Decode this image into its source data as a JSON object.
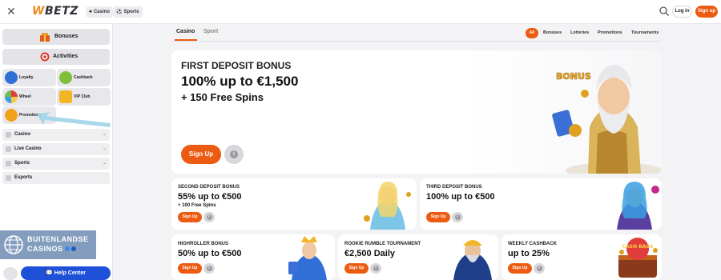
{
  "header": {
    "logo_w": "W",
    "logo_rest": "BETZ",
    "nav_pills": [
      {
        "icon": "cards-icon",
        "label": "Casino"
      },
      {
        "icon": "ball-icon",
        "label": "Sports"
      }
    ],
    "login_label": "Log in",
    "signup_label": "Sign up"
  },
  "sidebar": {
    "big_buttons": [
      {
        "label": "Bonuses",
        "icon": "gift-icon"
      },
      {
        "label": "Activities",
        "icon": "target-icon"
      }
    ],
    "tiles": [
      {
        "label": "Loyalty",
        "icon": "shield-icon"
      },
      {
        "label": "Cashback",
        "icon": "cash-icon"
      },
      {
        "label": "Wheel",
        "icon": "wheel-icon"
      },
      {
        "label": "VIP Club",
        "icon": "crown-icon"
      },
      {
        "label": "Promotions",
        "icon": "coin-icon"
      }
    ],
    "rows": [
      {
        "label": "Casino"
      },
      {
        "label": "Live Casino"
      },
      {
        "label": "Sports"
      },
      {
        "label": "Esports"
      }
    ],
    "help_label": "Help Center"
  },
  "watermark": {
    "line1": "BUITENLANDSE",
    "line2": "CASINOS"
  },
  "main": {
    "tabs": [
      {
        "label": "Casino",
        "active": true
      },
      {
        "label": "Sport",
        "active": false
      }
    ],
    "filters": [
      "All",
      "Bonuses",
      "Lotteries",
      "Promotions",
      "Tournaments"
    ],
    "hero": {
      "title": "FIRST DEPOSIT BONUS",
      "line1": "100% up to €1,500",
      "line2": "+ 150 Free Spins",
      "button": "Sign Up",
      "art_text": "BONUS"
    },
    "cards": [
      {
        "title": "SECOND DEPOSIT BONUS",
        "line1": "55% up to €500",
        "line2": "+ 100 Free Spins",
        "button": "Sign Up"
      },
      {
        "title": "THIRD DEPOSIT BONUS",
        "line1": "100% up to €500",
        "line2": "",
        "button": "Sign Up"
      },
      {
        "title": "HIGHROLLER BONUS",
        "line1": "50% up to €500",
        "line2": "",
        "button": "Sign Up"
      },
      {
        "title": "ROOKIE RUMBLE TOURNAMENT",
        "line1": "€2,500 Daily",
        "line2": "",
        "button": "Sign Up"
      },
      {
        "title": "WEEKLY CASHBACK",
        "line1": "up to 25%",
        "line2": "",
        "button": "Sign Up",
        "art_text": "CASH BACK"
      }
    ]
  },
  "colors": {
    "accent": "#ec5b12",
    "help_blue": "#1f50d8",
    "logo_orange": "#f08a1c"
  }
}
